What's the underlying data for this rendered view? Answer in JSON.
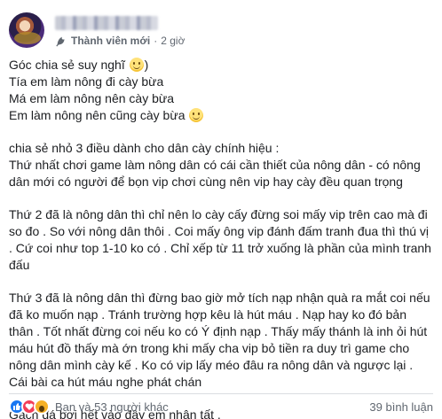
{
  "header": {
    "member_label": "Thành viên mới",
    "separator": "·",
    "time": "2 giờ"
  },
  "post": {
    "paragraphs": [
      [
        "Góc chia sẻ suy nghĩ {emoji})",
        "Tía em làm nông đi cày bừa",
        "Má em làm nông nên cày bừa",
        "Em làm nông nên cũng cày bừa {emoji}"
      ],
      [
        "chia sẻ nhỏ 3 điều dành cho dân cày chính hiệu :",
        "Thứ nhất chơi game làm nông dân có cái cần thiết của nông dân - có nông",
        "dân mới có người để bọn vip chơi cùng nên vip hay cày đều quan trọng"
      ],
      [
        "Thứ 2 đã là nông dân thì chỉ nên lo cày cấy đừng soi mấy vip trên cao mà đi",
        "so đo . So với nông dân thôi . Coi mấy ông vip đánh đấm tranh đua thì thú vị",
        ". Cứ coi như top 1-10 ko có . Chỉ xếp từ 11 trở xuống là phần của mình tranh",
        "đấu"
      ],
      [
        "Thứ 3 đã là nông dân thì đừng bao giờ mở tích nạp nhận quà ra mắt coi nếu",
        "đã ko muốn nạp . Tránh trường hợp kêu là hút máu . Nạp hay ko đó bản",
        "thân . Tốt nhất đừng coi nếu ko có Ý định nạp . Thấy mấy thánh là inh ỏi hút",
        "máu hút đồ thấy mà ớn trong khi mấy cha vip bỏ tiền ra duy trì game cho",
        "nông dân mình cày kế . Ko có vip lấy méo đâu ra nông dân và ngược lại .",
        "Cái bài ca hút máu nghe phát chán"
      ],
      [
        "Gạch đá bơi hết vào đây em nhận tất ."
      ]
    ]
  },
  "footer": {
    "reactions_text": "Bạn và 53 người khác",
    "comments_text": "39 bình luận"
  },
  "colors": {
    "text": "#1c1e21",
    "meta": "#606770",
    "like": "#1877f2",
    "love": "#f33e58",
    "wow": "#f7b125"
  }
}
